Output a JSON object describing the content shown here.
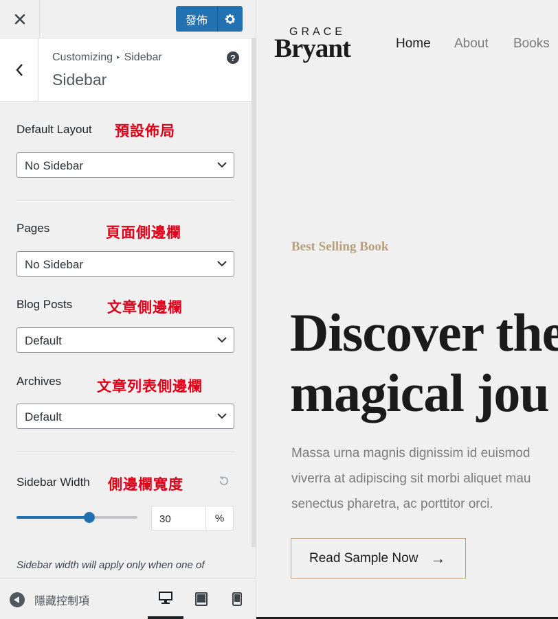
{
  "topbar": {
    "close_icon": "close-icon",
    "publish_label": "發佈",
    "settings_icon": "gear-icon"
  },
  "section": {
    "breadcrumb_root": "Customizing",
    "breadcrumb_current": "Sidebar",
    "title": "Sidebar",
    "help_glyph": "?"
  },
  "controls": {
    "default_layout": {
      "label": "Default Layout",
      "annotation": "預設佈局",
      "value": "No Sidebar"
    },
    "pages": {
      "label": "Pages",
      "annotation": "頁面側邊欄",
      "value": "No Sidebar"
    },
    "blog_posts": {
      "label": "Blog Posts",
      "annotation": "文章側邊欄",
      "value": "Default"
    },
    "archives": {
      "label": "Archives",
      "annotation": "文章列表側邊欄",
      "value": "Default"
    },
    "sidebar_width": {
      "label": "Sidebar Width",
      "annotation": "側邊欄寬度",
      "value": "30",
      "unit": "%",
      "slider_fraction": 0.6,
      "description": "Sidebar width will apply only when one of"
    }
  },
  "footer": {
    "collapse_label": "隱藏控制項",
    "devices": [
      "desktop",
      "tablet",
      "mobile"
    ],
    "active_device": "desktop"
  },
  "preview": {
    "logo_top": "GRACE",
    "logo_bottom": "Bryant",
    "nav": [
      "Home",
      "About",
      "Books"
    ],
    "eyebrow": "Best Selling Book",
    "headline_1": "Discover the",
    "headline_2": "magical jou",
    "body_lines": [
      "Massa urna magnis dignissim id euismod",
      "viverra at adipiscing sit morbi aliquet mau",
      "senectus pharetra, ac porttitor orci."
    ],
    "cta_label": "Read Sample Now",
    "cta_arrow": "→"
  },
  "colors": {
    "accent": "#2271b1",
    "annotation": "#e0001a",
    "gold": "#b8a07e"
  }
}
